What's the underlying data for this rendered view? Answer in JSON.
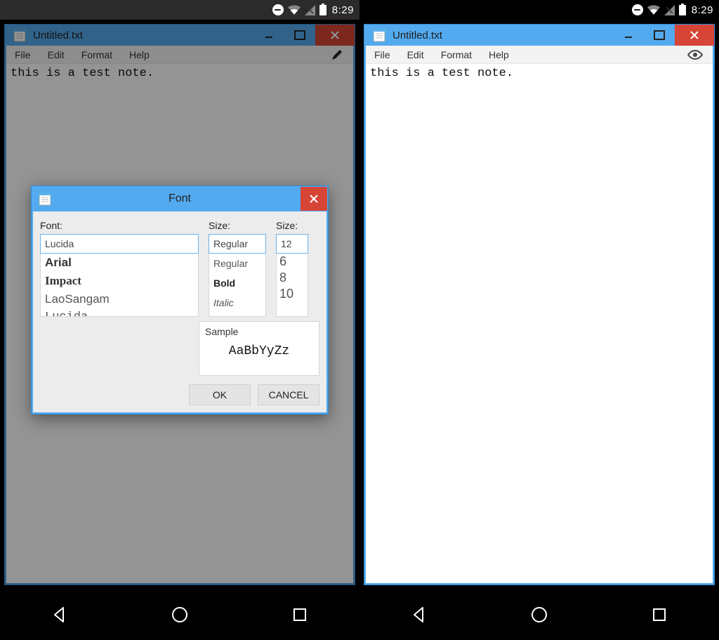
{
  "status": {
    "time": "8:29"
  },
  "window": {
    "title": "Untitled.txt",
    "menus": {
      "file": "File",
      "edit": "Edit",
      "format": "Format",
      "help": "Help"
    },
    "content": "this is a test note."
  },
  "dialog": {
    "title": "Font",
    "labels": {
      "font": "Font:",
      "style": "Size:",
      "size": "Size:"
    },
    "values": {
      "font": "Lucida",
      "style": "Regular",
      "size": "12"
    },
    "font_options": [
      "Arial",
      "Impact",
      "LaoSangam",
      "Lucida"
    ],
    "style_options": [
      "Regular",
      "Bold",
      "Italic"
    ],
    "size_options": [
      "6",
      "8",
      "10"
    ],
    "sample_label": "Sample",
    "sample_text": "AaBbYyZz",
    "buttons": {
      "ok": "OK",
      "cancel": "CANCEL"
    }
  }
}
